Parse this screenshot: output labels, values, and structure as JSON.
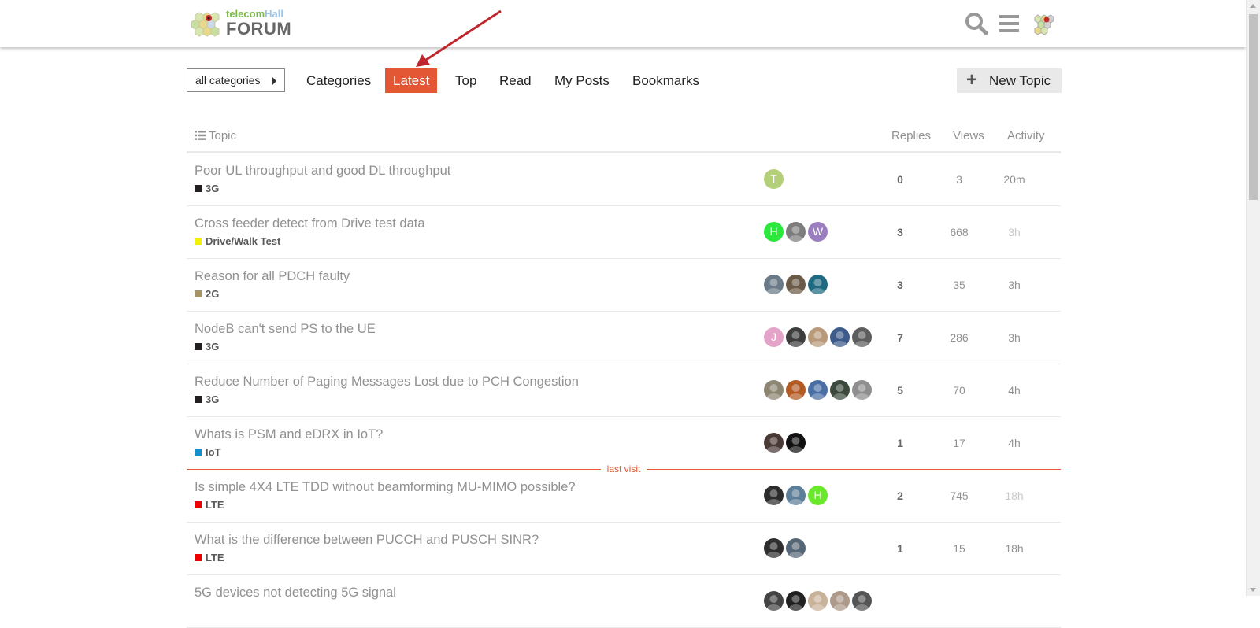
{
  "header": {
    "logo_small_1": "telecom",
    "logo_small_2": "Hall",
    "logo_main": "FORUM",
    "icons": [
      "search-icon",
      "hamburger-menu-icon",
      "user-avatar-icon"
    ]
  },
  "nav": {
    "category_dropdown": "all categories",
    "tabs": [
      {
        "label": "Categories",
        "active": false
      },
      {
        "label": "Latest",
        "active": true
      },
      {
        "label": "Top",
        "active": false
      },
      {
        "label": "Read",
        "active": false
      },
      {
        "label": "My Posts",
        "active": false
      },
      {
        "label": "Bookmarks",
        "active": false
      }
    ],
    "new_topic": "New Topic"
  },
  "table": {
    "headers": {
      "topic": "Topic",
      "replies": "Replies",
      "views": "Views",
      "activity": "Activity"
    },
    "last_visit_label": "last visit",
    "rows": [
      {
        "title": "Poor UL throughput and good DL throughput",
        "category": "3G",
        "cat_color": "#231f20",
        "posters": [
          {
            "letter": "T",
            "color": "#b3cf77"
          }
        ],
        "replies": "0",
        "views": "3",
        "activity": "20m",
        "faded": false
      },
      {
        "title": "Cross feeder detect from Drive test data",
        "category": "Drive/Walk Test",
        "cat_color": "#f1f100",
        "posters": [
          {
            "letter": "H",
            "color": "#2ae83c"
          },
          {
            "letter": "",
            "color": "#7d7d7d"
          },
          {
            "letter": "W",
            "color": "#9b7ec0"
          }
        ],
        "replies": "3",
        "views": "668",
        "activity": "3h",
        "faded": true
      },
      {
        "title": "Reason for all PDCH faulty",
        "category": "2G",
        "cat_color": "#a69563",
        "posters": [
          {
            "letter": "",
            "color": "#6a7a88"
          },
          {
            "letter": "",
            "color": "#6b5a48"
          },
          {
            "letter": "",
            "color": "#1f6a80"
          }
        ],
        "replies": "3",
        "views": "35",
        "activity": "3h",
        "faded": false
      },
      {
        "title": "NodeB can't send PS to the UE",
        "category": "3G",
        "cat_color": "#231f20",
        "posters": [
          {
            "letter": "J",
            "color": "#e4a3c9"
          },
          {
            "letter": "",
            "color": "#3d3d3d"
          },
          {
            "letter": "",
            "color": "#b89a7a"
          },
          {
            "letter": "",
            "color": "#3c5a8a"
          },
          {
            "letter": "",
            "color": "#5e5e5e"
          }
        ],
        "replies": "7",
        "views": "286",
        "activity": "3h",
        "faded": false
      },
      {
        "title": "Reduce Number of Paging Messages Lost due to PCH Congestion",
        "category": "3G",
        "cat_color": "#231f20",
        "posters": [
          {
            "letter": "",
            "color": "#8c8572"
          },
          {
            "letter": "",
            "color": "#b35a22"
          },
          {
            "letter": "",
            "color": "#4a6fa5"
          },
          {
            "letter": "",
            "color": "#3b4a3c"
          },
          {
            "letter": "",
            "color": "#8e8e8e"
          }
        ],
        "replies": "5",
        "views": "70",
        "activity": "4h",
        "faded": false
      },
      {
        "title": "Whats is PSM and eDRX in IoT?",
        "category": "IoT",
        "cat_color": "#0e8fce",
        "posters": [
          {
            "letter": "",
            "color": "#4a3a36"
          },
          {
            "letter": "",
            "color": "#111111"
          }
        ],
        "replies": "1",
        "views": "17",
        "activity": "4h",
        "faded": false,
        "last_visit_after": true
      },
      {
        "title": "Is simple 4X4 LTE TDD without beamforming MU-MIMO possible?",
        "category": "LTE",
        "cat_color": "#ee0000",
        "posters": [
          {
            "letter": "",
            "color": "#2c2c2c"
          },
          {
            "letter": "",
            "color": "#5d7e99"
          },
          {
            "letter": "H",
            "color": "#6ae82c"
          }
        ],
        "replies": "2",
        "views": "745",
        "activity": "18h",
        "faded": true
      },
      {
        "title": "What is the difference between PUCCH and PUSCH SINR?",
        "category": "LTE",
        "cat_color": "#ee0000",
        "posters": [
          {
            "letter": "",
            "color": "#2e2e2e"
          },
          {
            "letter": "",
            "color": "#556677"
          }
        ],
        "replies": "1",
        "views": "15",
        "activity": "18h",
        "faded": false
      },
      {
        "title": "5G devices not detecting 5G signal",
        "category": "",
        "cat_color": "#ffffff",
        "posters": [
          {
            "letter": "",
            "color": "#444444"
          },
          {
            "letter": "",
            "color": "#222222"
          },
          {
            "letter": "",
            "color": "#c9b29a"
          },
          {
            "letter": "",
            "color": "#ae9a8a"
          },
          {
            "letter": "",
            "color": "#555555"
          }
        ],
        "replies": "",
        "views": "",
        "activity": "",
        "faded": false
      }
    ]
  },
  "colors": {
    "accent": "#e45735",
    "muted_text": "#919191",
    "border": "#e9e9e9"
  }
}
